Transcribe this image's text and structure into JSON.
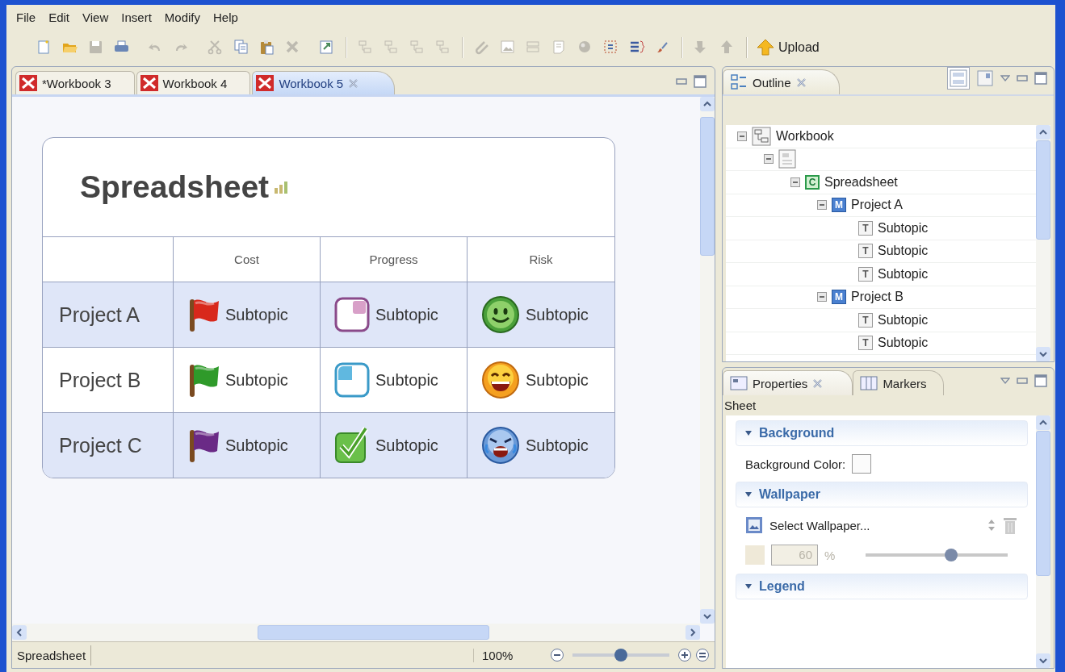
{
  "menu": [
    {
      "label": "File"
    },
    {
      "label": "Edit"
    },
    {
      "label": "View"
    },
    {
      "label": "Insert"
    },
    {
      "label": "Modify"
    },
    {
      "label": "Help"
    }
  ],
  "toolbar": [
    [
      {
        "kind": "new",
        "disabled": false
      },
      {
        "kind": "open",
        "disabled": false
      },
      {
        "kind": "save",
        "disabled": true
      },
      {
        "kind": "print",
        "disabled": false
      }
    ],
    [
      {
        "kind": "undo",
        "disabled": true
      },
      {
        "kind": "redo",
        "disabled": true
      }
    ],
    [
      {
        "kind": "cut",
        "disabled": true
      },
      {
        "kind": "copy",
        "disabled": false
      },
      {
        "kind": "paste",
        "disabled": false
      },
      {
        "kind": "delete",
        "disabled": true
      }
    ],
    [
      {
        "kind": "export",
        "disabled": false
      }
    ],
    [
      {
        "kind": "topic",
        "disabled": true
      },
      {
        "kind": "topic",
        "disabled": true
      },
      {
        "kind": "topic",
        "disabled": true
      },
      {
        "kind": "topic",
        "disabled": true
      }
    ],
    [
      {
        "kind": "link",
        "disabled": true
      },
      {
        "kind": "image",
        "disabled": true
      },
      {
        "kind": "split",
        "disabled": true
      },
      {
        "kind": "note",
        "disabled": true
      },
      {
        "kind": "ball",
        "disabled": true
      },
      {
        "kind": "boundary",
        "disabled": false
      },
      {
        "kind": "summary",
        "disabled": false
      },
      {
        "kind": "format",
        "disabled": false
      }
    ],
    [
      {
        "kind": "down",
        "disabled": true
      },
      {
        "kind": "up",
        "disabled": true
      }
    ]
  ],
  "upload_button": {
    "label": "Upload"
  },
  "editor": {
    "tabs": [
      {
        "label": "*Workbook 3",
        "selected": false
      },
      {
        "label": "Workbook 4",
        "selected": false
      },
      {
        "label": "Workbook 5",
        "selected": true
      }
    ],
    "sheet": {
      "title": "Spreadsheet",
      "columns": [
        "Cost",
        "Progress",
        "Risk"
      ],
      "rows": [
        {
          "label": "Project A",
          "shaded": true,
          "cells": [
            {
              "kind": "flag",
              "color": "#d8281c",
              "text": "Subtopic"
            },
            {
              "kind": "task-start",
              "text": "Subtopic"
            },
            {
              "kind": "smiley-smile",
              "text": "Subtopic"
            }
          ]
        },
        {
          "label": "Project B",
          "shaded": false,
          "cells": [
            {
              "kind": "flag",
              "color": "#2f9a2a",
              "text": "Subtopic"
            },
            {
              "kind": "task-quarter",
              "text": "Subtopic"
            },
            {
              "kind": "smiley-laugh",
              "text": "Subtopic"
            }
          ]
        },
        {
          "label": "Project C",
          "shaded": true,
          "cells": [
            {
              "kind": "flag",
              "color": "#6a2a86",
              "text": "Subtopic"
            },
            {
              "kind": "task-done",
              "text": "Subtopic"
            },
            {
              "kind": "smiley-cry",
              "text": "Subtopic"
            }
          ]
        }
      ]
    },
    "status": {
      "sheet_tab": "Spreadsheet",
      "zoom": "100%",
      "zoom_slider": {
        "level": 0.5
      }
    }
  },
  "outline": {
    "tab": {
      "label": "Outline"
    },
    "tree": [
      {
        "kind": "workbook",
        "label": "Workbook",
        "expanded": true,
        "children": [
          {
            "kind": "sheet",
            "expanded": true,
            "children": [
              {
                "kind": "central",
                "glyph": "C",
                "label": "Spreadsheet",
                "expanded": true,
                "children": [
                  {
                    "kind": "main",
                    "glyph": "M",
                    "label": "Project A",
                    "expanded": true,
                    "children": [
                      {
                        "kind": "sub",
                        "glyph": "T",
                        "label": "Subtopic"
                      },
                      {
                        "kind": "sub",
                        "glyph": "T",
                        "label": "Subtopic"
                      },
                      {
                        "kind": "sub",
                        "glyph": "T",
                        "label": "Subtopic"
                      }
                    ]
                  },
                  {
                    "kind": "main",
                    "glyph": "M",
                    "label": "Project B",
                    "expanded": true,
                    "children": [
                      {
                        "kind": "sub",
                        "glyph": "T",
                        "label": "Subtopic"
                      },
                      {
                        "kind": "sub",
                        "glyph": "T",
                        "label": "Subtopic"
                      }
                    ]
                  }
                ]
              }
            ]
          }
        ]
      }
    ]
  },
  "properties": {
    "tabs": [
      {
        "label": "Properties",
        "selected": true
      },
      {
        "label": "Markers",
        "selected": false
      }
    ],
    "heading": "Sheet",
    "sections": [
      {
        "kind": "background",
        "title": "Background",
        "expanded": true,
        "color_label": "Background Color:"
      },
      {
        "kind": "wallpaper",
        "title": "Wallpaper",
        "expanded": true,
        "select_label": "Select Wallpaper...",
        "opacity": {
          "value": "60",
          "unit": "%",
          "disabled": true,
          "level": 0.6
        }
      },
      {
        "kind": "legend",
        "title": "Legend",
        "expanded": true
      }
    ]
  }
}
